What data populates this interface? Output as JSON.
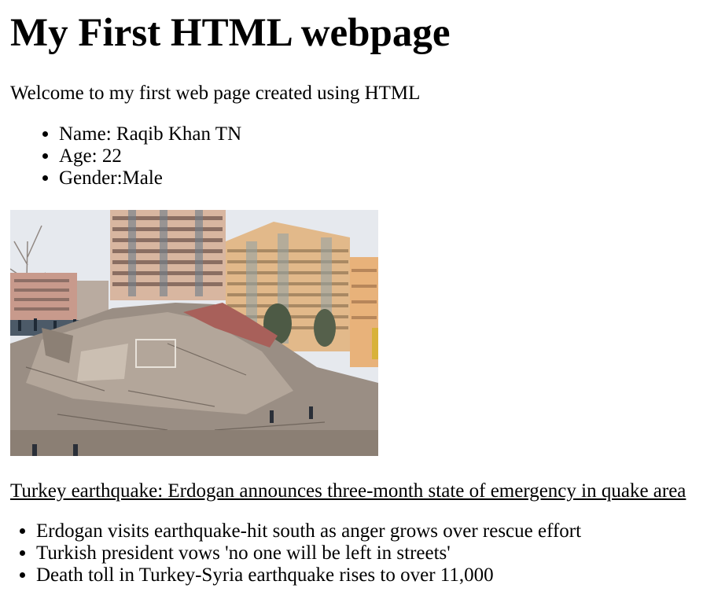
{
  "page": {
    "heading": "My First HTML webpage",
    "intro": "Welcome to my first web page created using HTML"
  },
  "profile": {
    "items": [
      "Name: Raqib Khan TN",
      "Age: 22",
      "Gender:Male"
    ]
  },
  "photo": {
    "alt": "Collapsed buildings after earthquake"
  },
  "news": {
    "headline": "Turkey earthquake: Erdogan announces three-month state of emergency in quake area",
    "items": [
      "Erdogan visits earthquake-hit south as anger grows over rescue effort",
      "Turkish president vows 'no one will be left in streets'",
      "Death toll in Turkey-Syria earthquake rises to over 11,000"
    ]
  }
}
